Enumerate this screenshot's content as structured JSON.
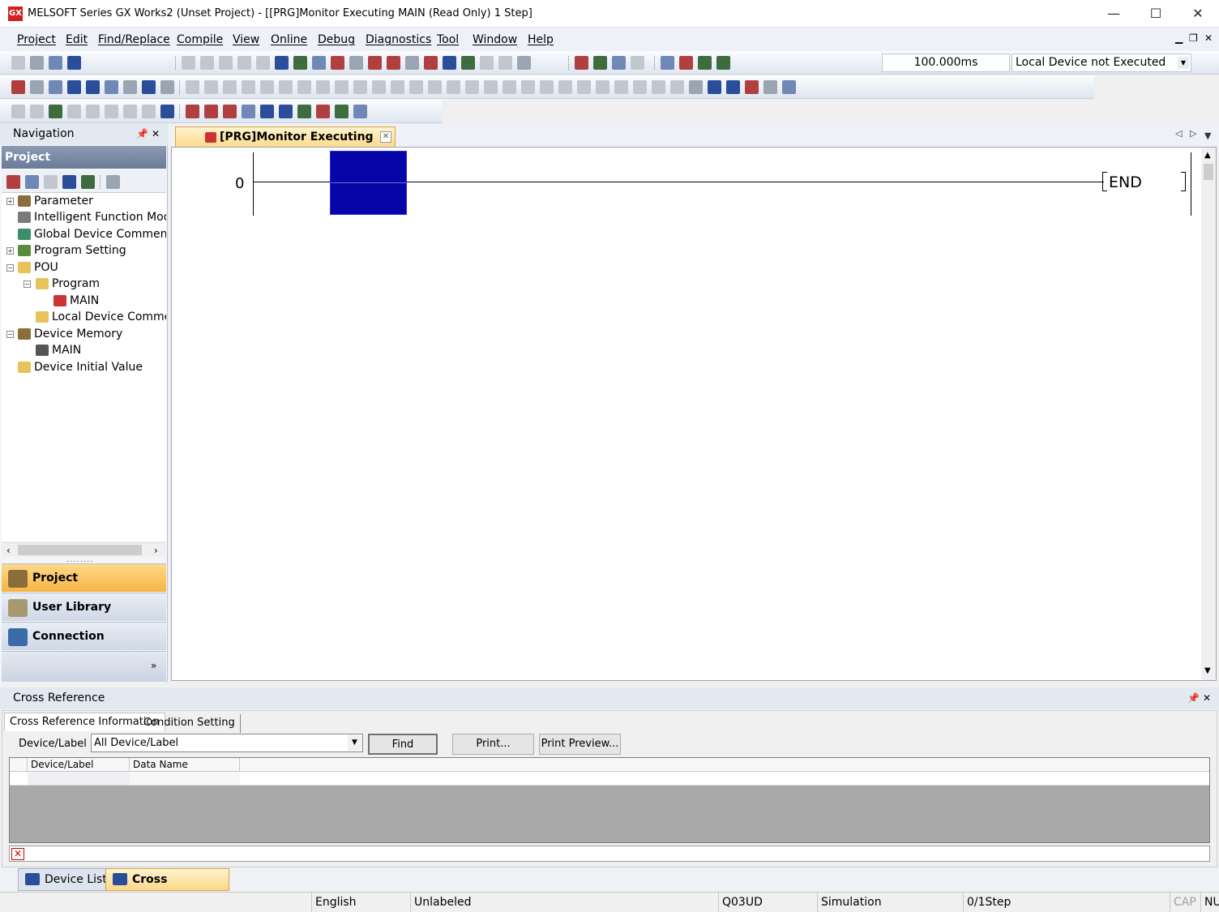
{
  "window": {
    "title": "MELSOFT Series GX Works2 (Unset Project) - [[PRG]Monitor Executing MAIN (Read Only) 1 Step]",
    "app_icon": "GX"
  },
  "menu": [
    "Project",
    "Edit",
    "Find/Replace",
    "Compile",
    "View",
    "Online",
    "Debug",
    "Diagnostics",
    "Tool",
    "Window",
    "Help"
  ],
  "toolbar": {
    "scan_time": "100.000ms",
    "device_status": "Local Device not Executed"
  },
  "navigation": {
    "title": "Navigation",
    "section": "Project",
    "tree": [
      "Parameter",
      "Intelligent Function Module",
      "Global Device Comment",
      "Program Setting",
      "POU",
      "Program",
      "MAIN",
      "Local Device Comment",
      "Device Memory",
      "MAIN",
      "Device Initial Value"
    ],
    "buttons": [
      "Project",
      "User Library",
      "Connection Destination"
    ]
  },
  "editor": {
    "tab_title": "[PRG]Monitor Executing M...",
    "step_number": "0",
    "end_instruction": "END"
  },
  "cross_reference": {
    "title": "Cross Reference",
    "tabs": [
      "Cross Reference Information",
      "Condition Setting"
    ],
    "device_label": "Device/Label",
    "device_value": "All Device/Label",
    "find": "Find",
    "print": "Print...",
    "print_preview": "Print Preview...",
    "columns": [
      "Device/Label",
      "Data Name"
    ]
  },
  "bottom_tabs": [
    "Device List",
    "Cross Reference"
  ],
  "status": {
    "language": "English",
    "label_mode": "Unlabeled",
    "cpu": "Q03UD",
    "connection": "Simulation",
    "steps": "0/1Step",
    "caps": "CAP",
    "num": "NU"
  },
  "colors": {
    "cursor": "#0505a8",
    "active_tab": "#fbd98a",
    "panel_header": "#e3e9f1"
  }
}
